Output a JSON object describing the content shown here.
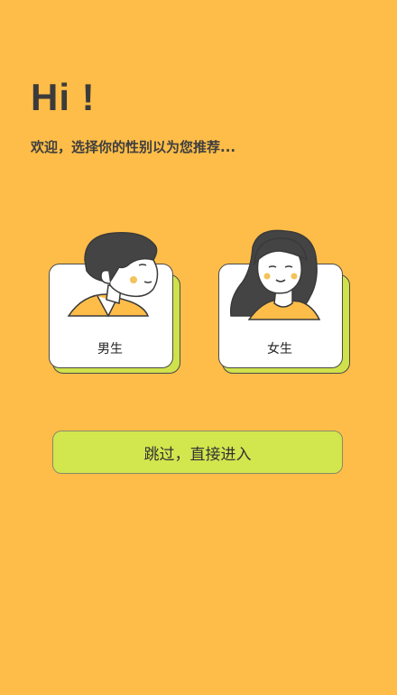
{
  "header": {
    "greeting": "Hi !",
    "subtitle": "欢迎，选择你的性别以为您推荐..."
  },
  "gender_options": [
    {
      "label": "男生",
      "icon": "male-avatar-icon"
    },
    {
      "label": "女生",
      "icon": "female-avatar-icon"
    }
  ],
  "skip_button": {
    "label": "跳过，直接进入"
  },
  "colors": {
    "background": "#FEBD48",
    "card_shadow": "#CFE24B",
    "button": "#D2E64E",
    "card_bg": "#FFFFFF"
  }
}
